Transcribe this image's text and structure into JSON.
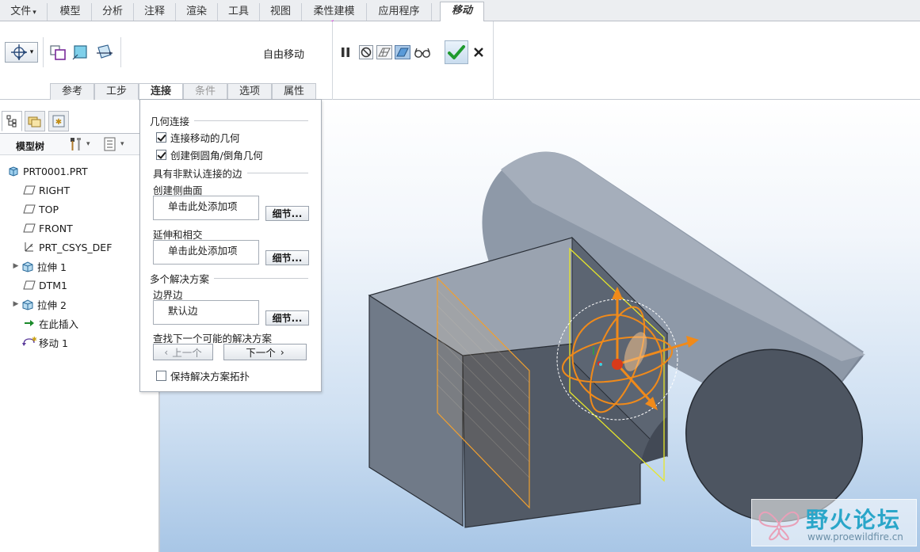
{
  "tabs": [
    {
      "label": "文件",
      "active": false
    },
    {
      "label": "模型",
      "active": false
    },
    {
      "label": "分析",
      "active": false
    },
    {
      "label": "注释",
      "active": false
    },
    {
      "label": "渲染",
      "active": false
    },
    {
      "label": "工具",
      "active": false
    },
    {
      "label": "视图",
      "active": false
    },
    {
      "label": "柔性建模",
      "active": false
    },
    {
      "label": "应用程序",
      "active": false
    },
    {
      "label": "移动",
      "active": true
    }
  ],
  "ribbon": {
    "dash_label": "自由移动",
    "subtabs": [
      {
        "label": "参考",
        "state": "normal"
      },
      {
        "label": "工步",
        "state": "normal"
      },
      {
        "label": "连接",
        "state": "active"
      },
      {
        "label": "条件",
        "state": "disabled"
      },
      {
        "label": "选项",
        "state": "normal"
      },
      {
        "label": "属性",
        "state": "normal"
      }
    ]
  },
  "navigator": {
    "title": "模型树",
    "items": [
      {
        "label": "PRT0001.PRT",
        "icon": "part-icon",
        "expand": false
      },
      {
        "label": "RIGHT",
        "icon": "datum-plane-icon",
        "expand": false
      },
      {
        "label": "TOP",
        "icon": "datum-plane-icon",
        "expand": false
      },
      {
        "label": "FRONT",
        "icon": "datum-plane-icon",
        "expand": false
      },
      {
        "label": "PRT_CSYS_DEF",
        "icon": "csys-icon",
        "expand": false
      },
      {
        "label": "拉伸 1",
        "icon": "extrude-icon",
        "expand": true
      },
      {
        "label": "DTM1",
        "icon": "datum-plane-icon",
        "expand": false
      },
      {
        "label": "拉伸 2",
        "icon": "extrude-icon",
        "expand": true
      },
      {
        "label": "在此插入",
        "icon": "insert-here-icon",
        "expand": false
      },
      {
        "label": "移动 1",
        "icon": "move-feature-icon",
        "expand": false
      }
    ]
  },
  "panel": {
    "geom_group": "几何连接",
    "chk_connect_moved": "连接移动的几何",
    "chk_connect_moved_on": true,
    "chk_round_chamfer": "创建倒圆角/倒角几何",
    "chk_round_chamfer_on": true,
    "nondefault_group": "具有非默认连接的边",
    "side_surface_label": "创建侧曲面",
    "side_surface_placeholder": "单击此处添加项",
    "extend_label": "延伸和相交",
    "extend_placeholder": "单击此处添加项",
    "details_label": "细节...",
    "multi_group": "多个解决方案",
    "boundary_label": "边界边",
    "boundary_value": "默认边",
    "find_next_label": "查找下一个可能的解决方案",
    "prev_label": "上一个",
    "next_label": "下一个",
    "keep_topology": "保持解决方案拓扑",
    "keep_topology_on": false
  },
  "watermark": {
    "title": "野火论坛",
    "url": "www.proewildfire.cn"
  }
}
